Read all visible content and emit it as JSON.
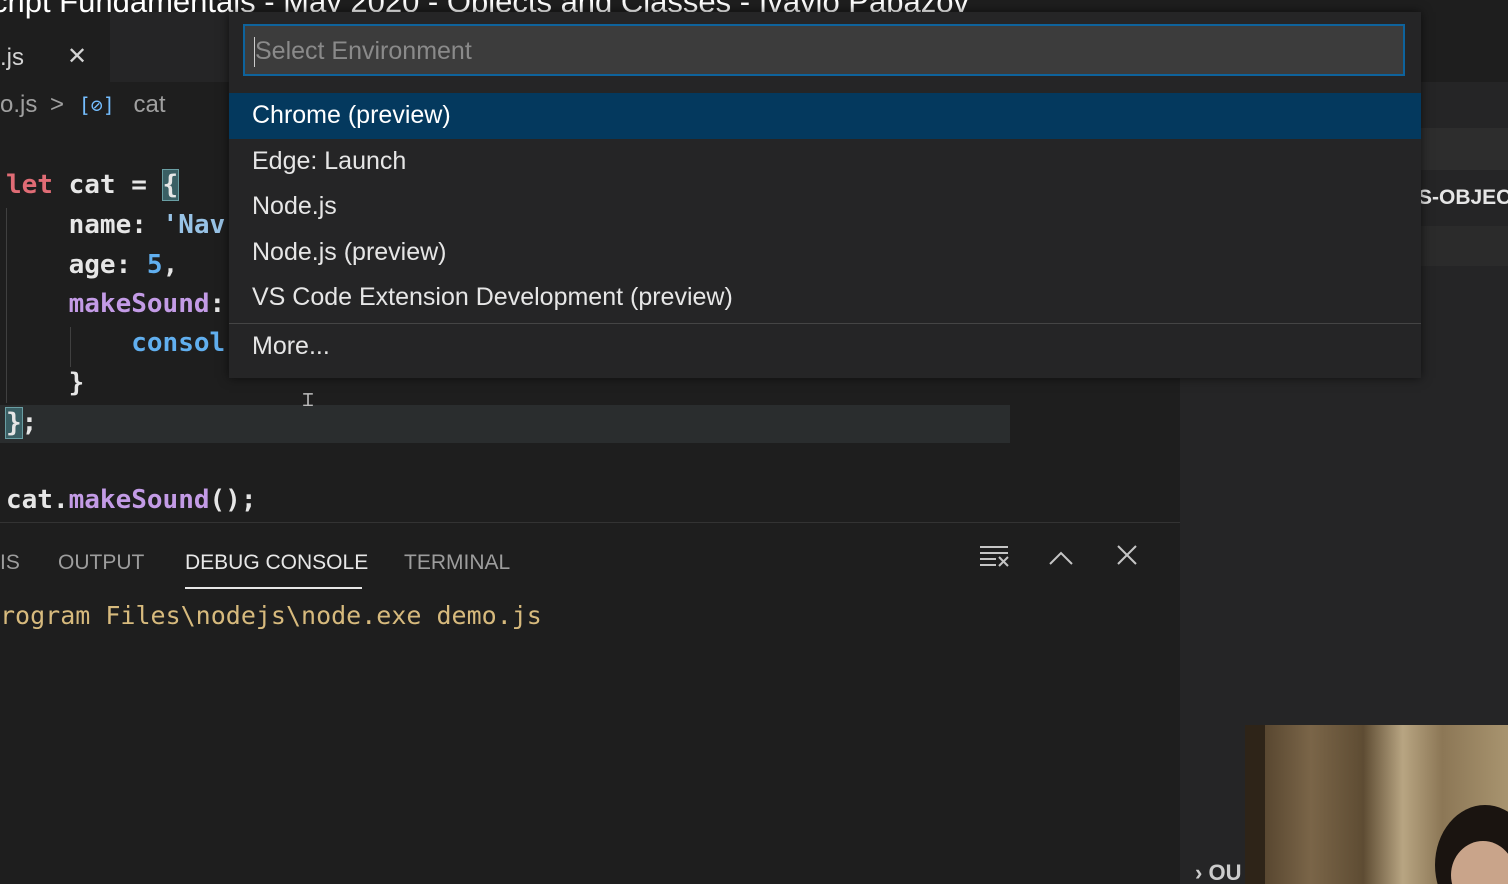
{
  "video_title": "cript Fundamentals - May 2020 - Objects and Classes - Ivaylo Papazov",
  "editor_tab": {
    "name": ".js",
    "close_glyph": "✕"
  },
  "breadcrumb": {
    "file": "o.js",
    "separator": ">",
    "symbol_icon": "[⊘]",
    "symbol": "cat"
  },
  "code": {
    "lines": [
      {
        "kw": "let",
        "rest": " cat = ",
        "brace": "{"
      },
      {
        "indent": "    ",
        "prop": "name:",
        "str": " 'Nav"
      },
      {
        "indent": "    ",
        "prop": "age:",
        "num": " 5",
        "tail": ","
      },
      {
        "indent": "    ",
        "method": "makeSound",
        "tail": ":"
      },
      {
        "indent": "        ",
        "fn": "consol"
      },
      {
        "indent": "    ",
        "tail": "}"
      },
      {
        "brace": "}",
        "tail": ";"
      },
      {
        "obj": "cat",
        "dot": ".",
        "method": "makeSound",
        "tail": "();"
      }
    ]
  },
  "quick_pick": {
    "placeholder": "Select Environment",
    "items": [
      {
        "label": "Chrome (preview)",
        "selected": true
      },
      {
        "label": "Edge: Launch",
        "selected": false
      },
      {
        "label": "Node.js",
        "selected": false
      },
      {
        "label": "Node.js (preview)",
        "selected": false
      },
      {
        "label": "VS Code Extension Development (preview)",
        "selected": false
      }
    ],
    "more_label": "More..."
  },
  "panel": {
    "tabs": [
      {
        "label": "IS",
        "active": false
      },
      {
        "label": "OUTPUT",
        "active": false
      },
      {
        "label": "DEBUG CONSOLE",
        "active": true
      },
      {
        "label": "TERMINAL",
        "active": false
      }
    ],
    "console_output": "rogram Files\\nodejs\\node.exe demo.js"
  },
  "right_panel": {
    "section_label": "S-OBJEC",
    "bottom_label": "OU"
  },
  "colors": {
    "editor_bg": "#1e1e1e",
    "selection": "#04395e",
    "focus_border": "#0e639c",
    "console_text": "#d7ba7d"
  }
}
